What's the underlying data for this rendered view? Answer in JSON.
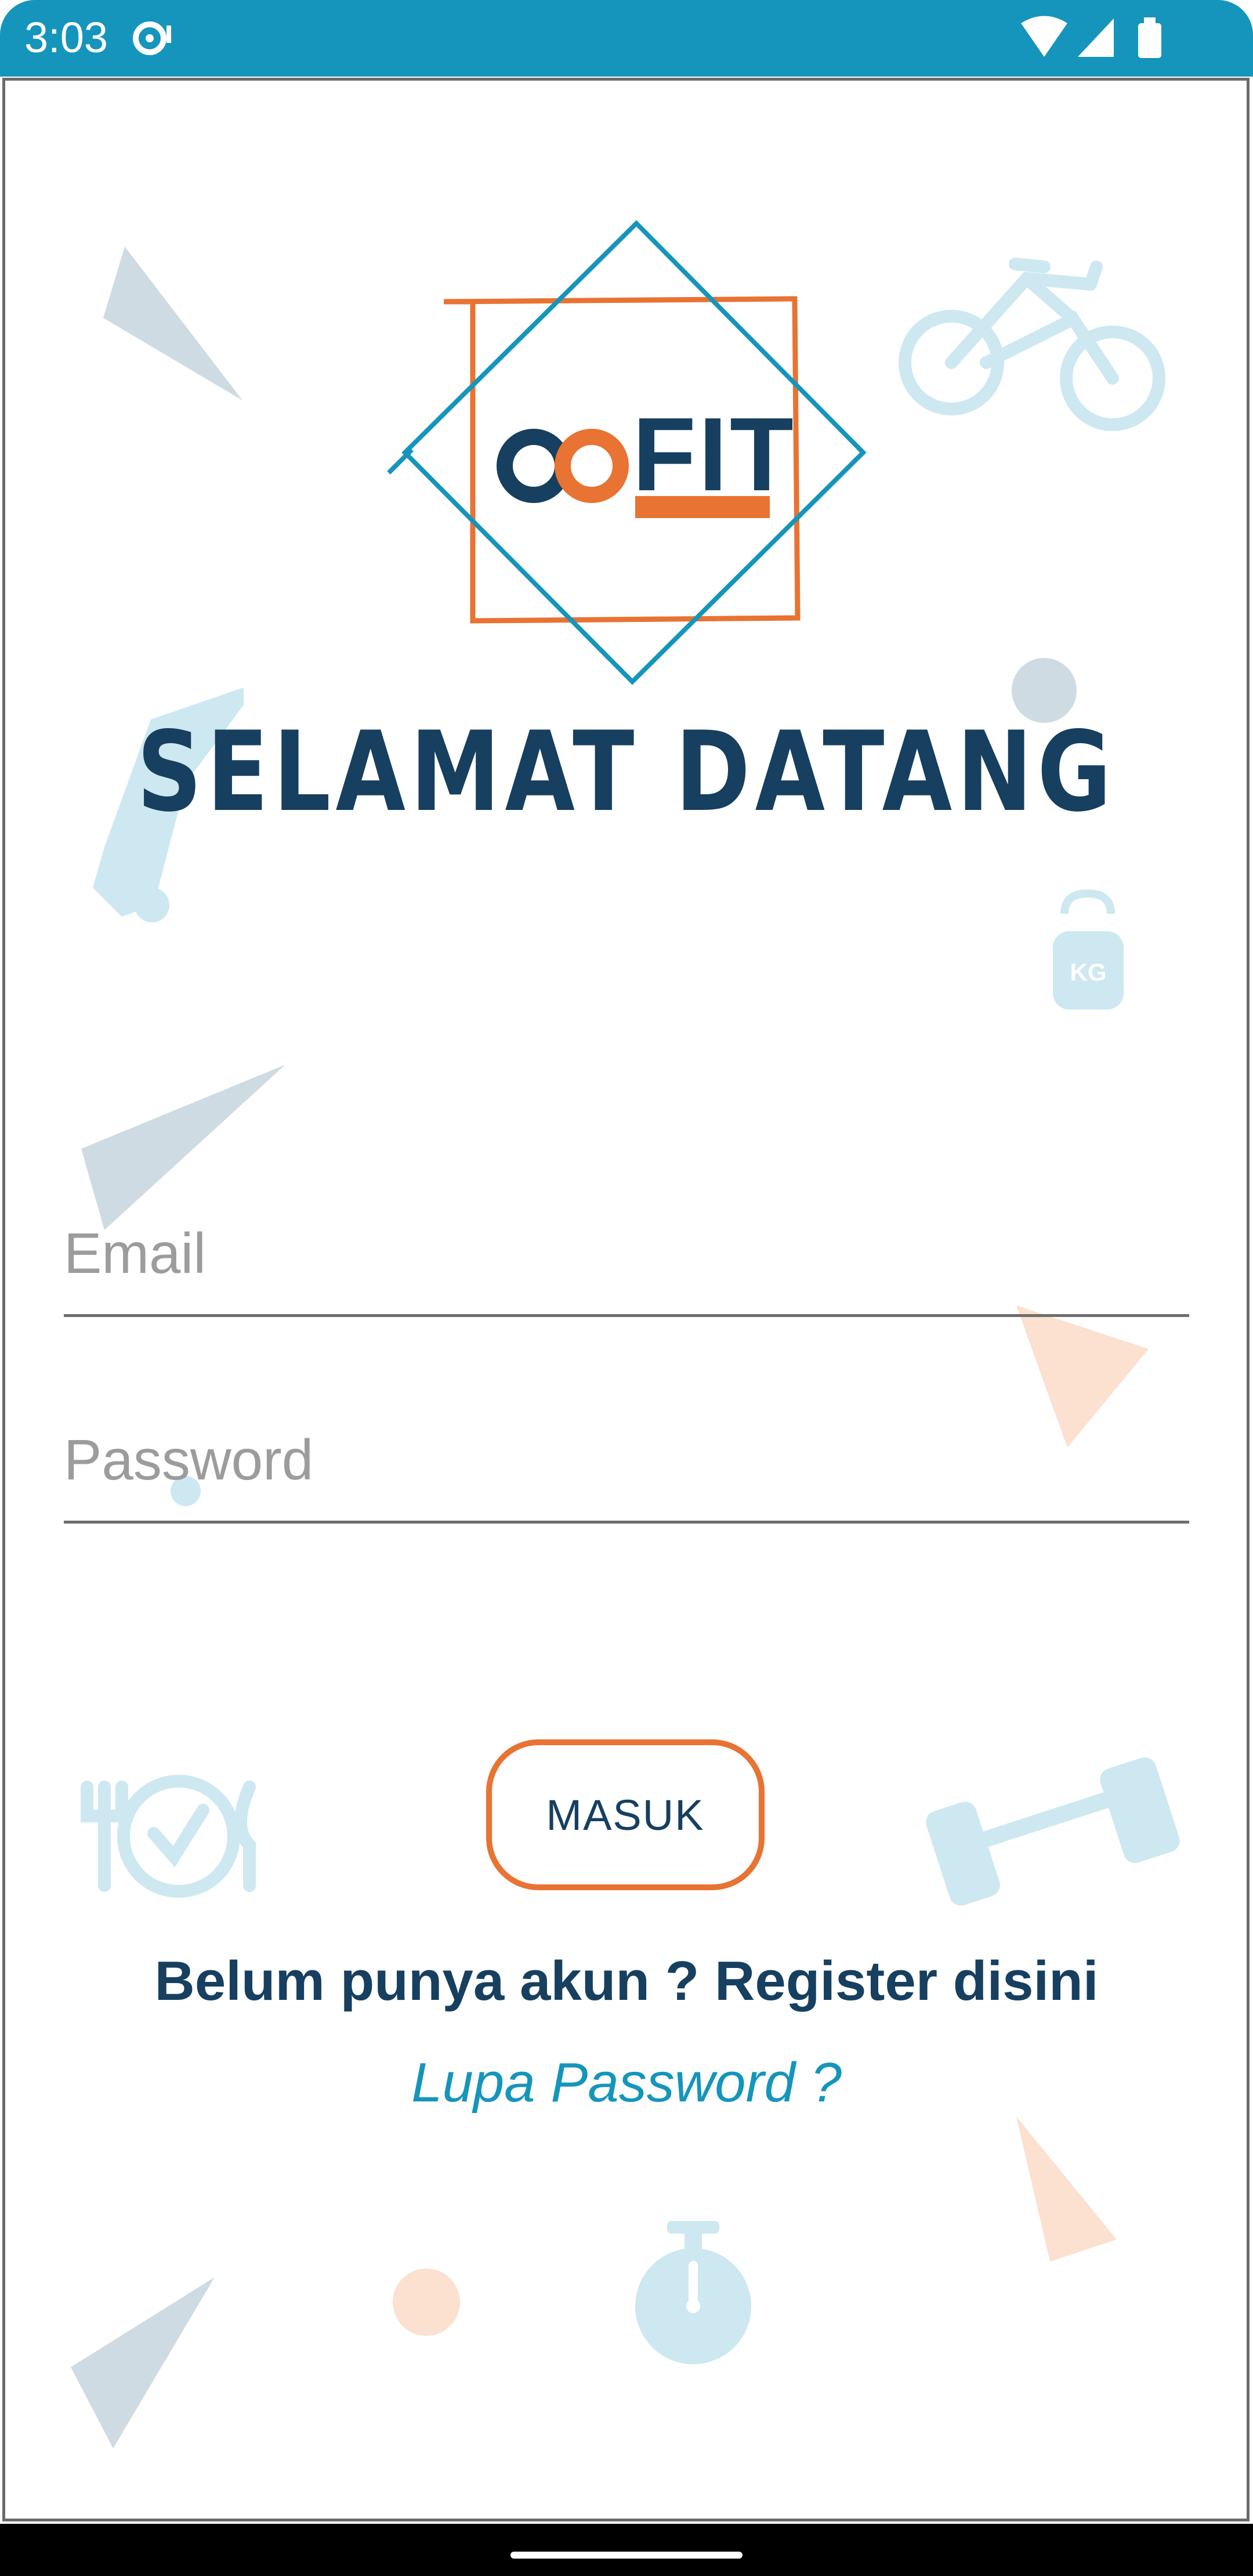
{
  "status_bar": {
    "time": "3:03",
    "icons": [
      "media-icon",
      "wifi-icon",
      "signal-icon",
      "battery-icon"
    ]
  },
  "logo": {
    "word": "FIT"
  },
  "welcome_title": "SELAMAT DATANG",
  "form": {
    "email_placeholder": "Email",
    "email_value": "",
    "password_placeholder": "Password",
    "password_value": ""
  },
  "login_button": "MASUK",
  "register_link": "Belum punya akun ? Register disini",
  "forgot_link": "Lupa Password ?",
  "colors": {
    "primary_dark": "#163f60",
    "accent_orange": "#e87332",
    "accent_blue": "#1595bb",
    "status_bar": "#1595bb"
  },
  "decorations": [
    "triangle-icon",
    "bicycle-icon",
    "dumbbell-icon",
    "kettlebell-icon",
    "plate-utensils-icon",
    "stopwatch-icon",
    "circle-icon"
  ]
}
